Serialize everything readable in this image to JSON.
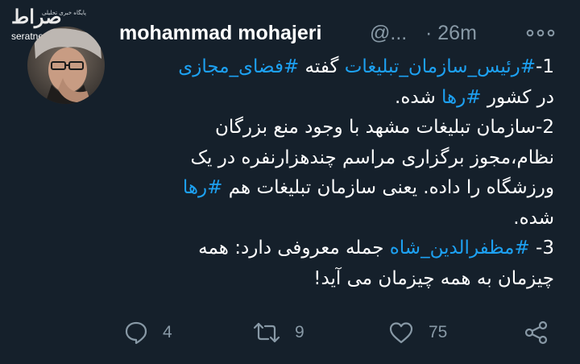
{
  "watermark": {
    "logo": "صراط",
    "tagline": "پایگاه خبری تحلیلی",
    "site": "seratnews.ir"
  },
  "tweet": {
    "author_name": "mohammad mohajeri",
    "handle": "@...",
    "time": "· 26m",
    "lines": [
      [
        [
          "1-",
          ""
        ],
        [
          "#رئیس_سازمان_تبلیغات",
          "tag"
        ],
        [
          " گفته ",
          ""
        ],
        [
          "#فضای_مجازی",
          "tag"
        ]
      ],
      [
        [
          "در کشور ",
          ""
        ],
        [
          "#رها",
          "tag"
        ],
        [
          " شده.",
          ""
        ]
      ],
      [
        [
          "2-سازمان تبلیغات مشهد با وجود منع بزرگان",
          ""
        ]
      ],
      [
        [
          "نظام،مجوز برگزاری مراسم چندهزارنفره در یک",
          ""
        ]
      ],
      [
        [
          "ورزشگاه را داده. یعنی سازمان تبلیغات هم ",
          ""
        ],
        [
          "#رها",
          "tag"
        ]
      ],
      [
        [
          "شده.",
          ""
        ]
      ],
      [
        [
          "3- ",
          ""
        ],
        [
          "#مظفرالدین_شاه",
          "tag"
        ],
        [
          " جمله معروفی دارد: همه",
          ""
        ]
      ],
      [
        [
          "چیزمان به همه چیزمان می آید!",
          ""
        ]
      ]
    ]
  },
  "actions": {
    "reply_count": "4",
    "retweet_count": "9",
    "like_count": "75"
  },
  "icons": {
    "more": "more-horizontal-icon",
    "reply": "reply-icon",
    "retweet": "retweet-icon",
    "like": "heart-icon",
    "share": "share-icon"
  },
  "colors": {
    "background": "#15202b",
    "text": "#ffffff",
    "secondary": "#8899a6",
    "hashtag": "#1da1f2"
  }
}
